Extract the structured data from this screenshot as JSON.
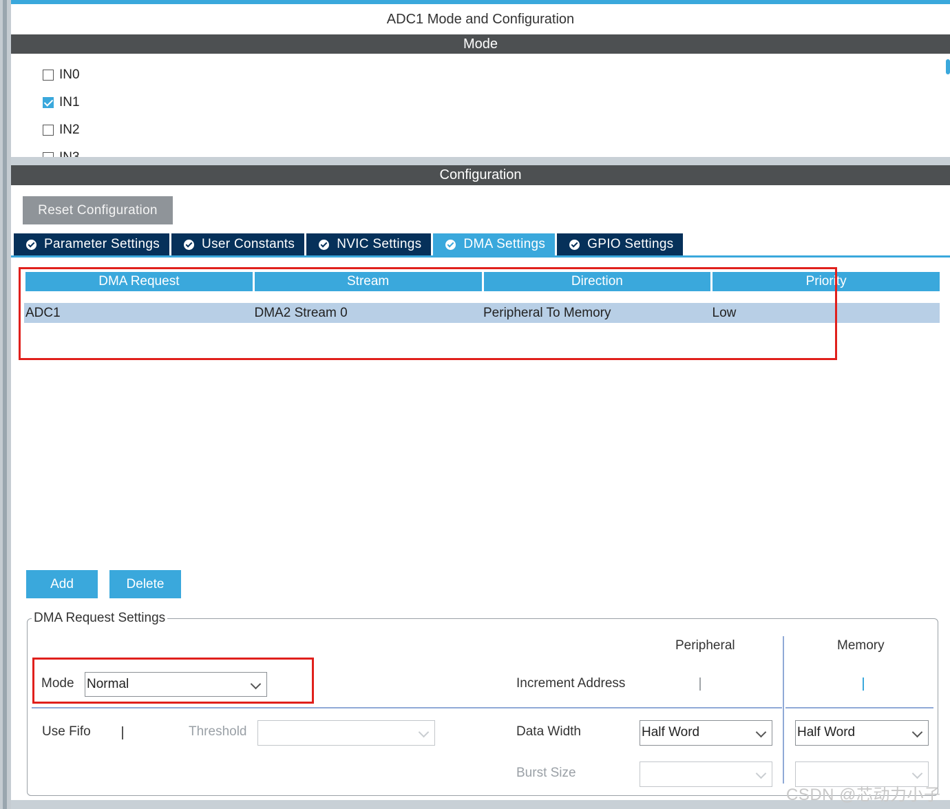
{
  "window": {
    "title": "ADC1 Mode and Configuration"
  },
  "mode": {
    "header": "Mode",
    "channels": [
      {
        "label": "IN0",
        "checked": false
      },
      {
        "label": "IN1",
        "checked": true
      },
      {
        "label": "IN2",
        "checked": false
      },
      {
        "label": "IN3",
        "checked": false
      }
    ]
  },
  "configuration": {
    "header": "Configuration",
    "reset_label": "Reset Configuration",
    "tabs": [
      {
        "label": "Parameter Settings",
        "active": false
      },
      {
        "label": "User Constants",
        "active": false
      },
      {
        "label": "NVIC Settings",
        "active": false
      },
      {
        "label": "DMA Settings",
        "active": true
      },
      {
        "label": "GPIO Settings",
        "active": false
      }
    ]
  },
  "dma_table": {
    "columns": [
      "DMA Request",
      "Stream",
      "Direction",
      "Priority"
    ],
    "rows": [
      [
        "ADC1",
        "DMA2 Stream 0",
        "Peripheral To Memory",
        "Low"
      ]
    ]
  },
  "buttons": {
    "add": "Add",
    "delete": "Delete"
  },
  "request_settings": {
    "legend": "DMA Request Settings",
    "mode_label": "Mode",
    "mode_value": "Normal",
    "peripheral_header": "Peripheral",
    "memory_header": "Memory",
    "increment_label": "Increment Address",
    "increment_peripheral": false,
    "increment_memory": true,
    "use_fifo_label": "Use Fifo",
    "use_fifo": false,
    "threshold_label": "Threshold",
    "threshold_value": "",
    "data_width_label": "Data Width",
    "data_width_peripheral": "Half Word",
    "data_width_memory": "Half Word",
    "burst_size_label": "Burst Size",
    "burst_peripheral": "",
    "burst_memory": ""
  },
  "watermark": "CSDN @芯动力小子",
  "colors": {
    "accent": "#3aa8dc",
    "tab_dark": "#06315a",
    "header_dark": "#4d5052",
    "highlight_red": "#e0201c",
    "row_selected": "#b8cfe6"
  }
}
